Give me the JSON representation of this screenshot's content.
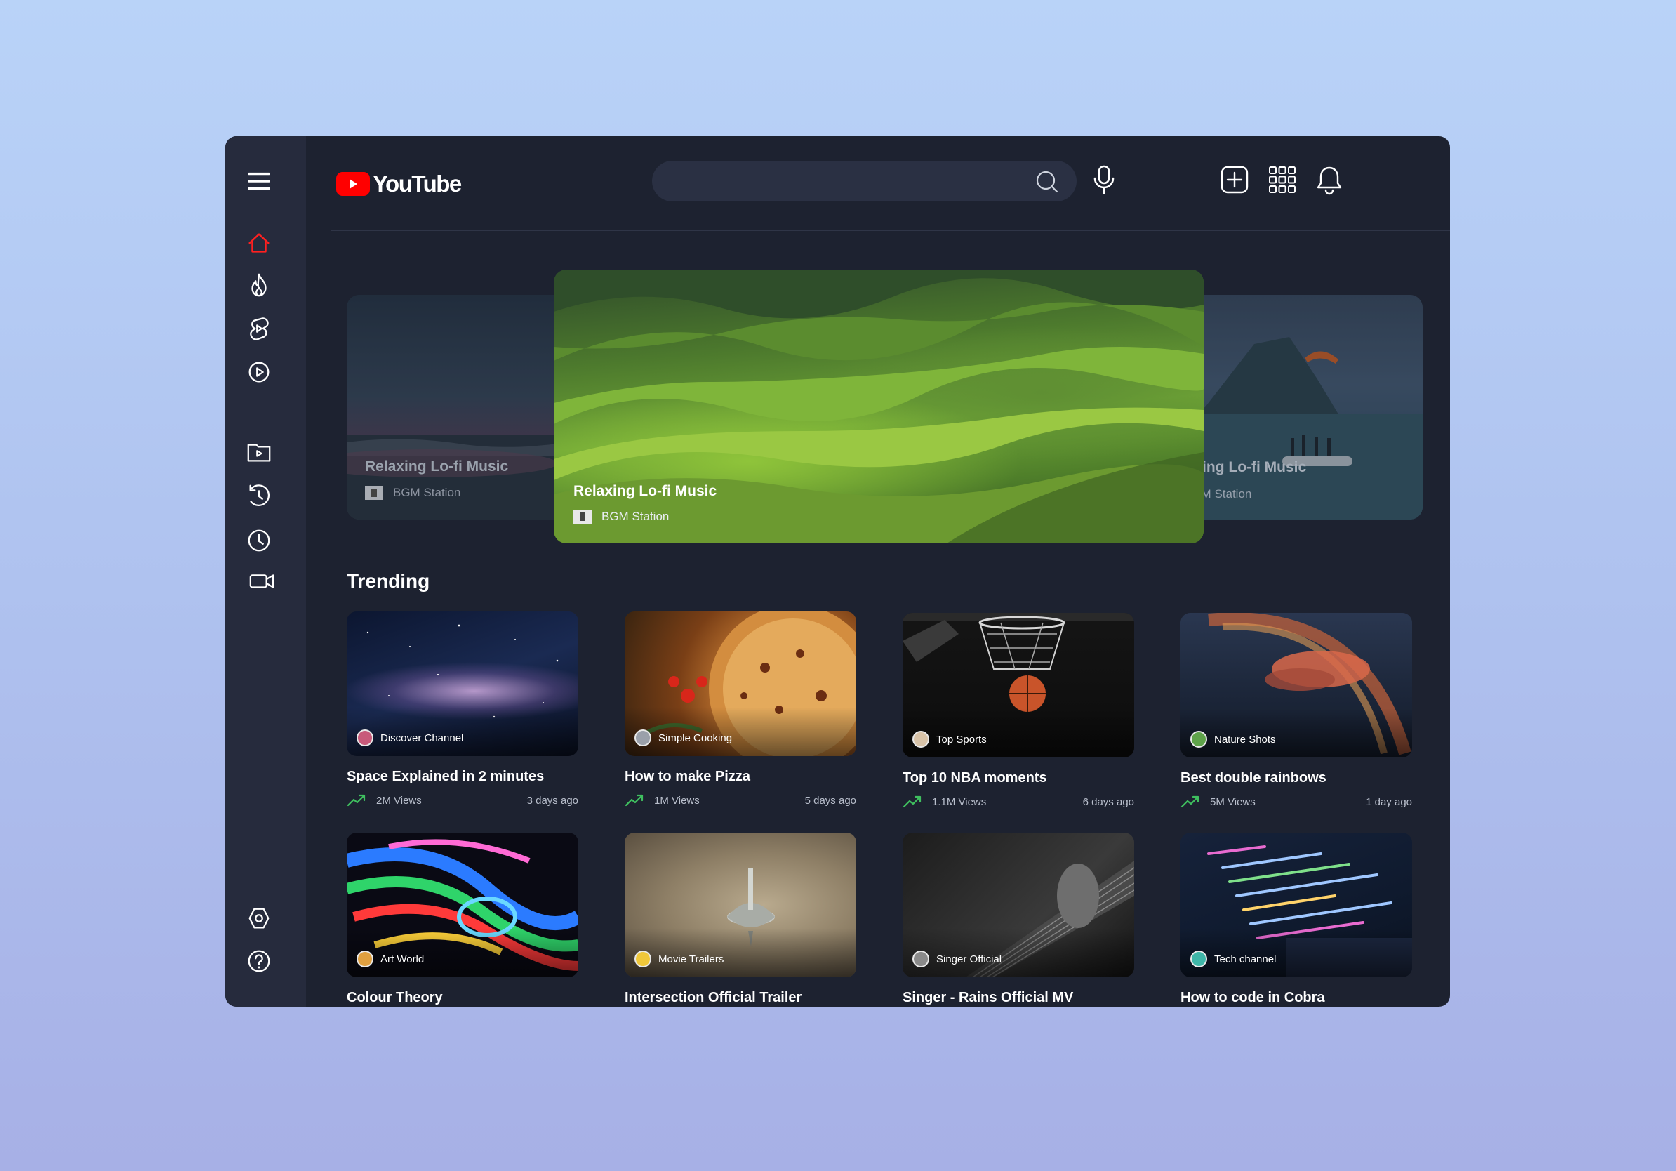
{
  "app": {
    "logo_text": "YouTube"
  },
  "search": {
    "placeholder": ""
  },
  "hero": {
    "left": {
      "title": "Relaxing Lo-fi Music",
      "channel": "BGM Station"
    },
    "main": {
      "title": "Relaxing Lo-fi Music",
      "channel": "BGM Station"
    },
    "right": {
      "title": "Relaxing Lo-fi Music",
      "channel": "BGM Station"
    }
  },
  "trending": {
    "title": "Trending",
    "cards": [
      {
        "title": "Space Explained in 2 minutes",
        "channel": "Discover Channel",
        "views": "2M Views",
        "age": "3 days ago"
      },
      {
        "title": "How to make Pizza",
        "channel": "Simple Cooking",
        "views": "1M Views",
        "age": "5 days ago"
      },
      {
        "title": "Top 10 NBA moments",
        "channel": "Top Sports",
        "views": "1.1M Views",
        "age": "6 days ago"
      },
      {
        "title": "Best double rainbows",
        "channel": "Nature Shots",
        "views": "5M Views",
        "age": "1 day ago"
      },
      {
        "title": "Colour Theory",
        "channel": "Art World"
      },
      {
        "title": "Intersection Official Trailer",
        "channel": "Movie Trailers"
      },
      {
        "title": "Singer - Rains Official MV",
        "channel": "Singer Official"
      },
      {
        "title": "How to code in Cobra",
        "channel": "Tech channel"
      }
    ]
  },
  "colors": {
    "accent": "#ff0000",
    "background": "#1d2230",
    "sidebar": "#262b3d",
    "trend": "#3fbf5f"
  },
  "icons": {
    "sidebar": [
      "menu-icon",
      "home-icon",
      "trending-icon",
      "shorts-icon",
      "subscriptions-icon",
      "library-icon",
      "history-icon",
      "watch-later-icon",
      "your-videos-icon",
      "settings-icon",
      "help-icon"
    ],
    "header": [
      "search-icon",
      "mic-icon",
      "create-icon",
      "apps-icon",
      "bell-icon"
    ]
  }
}
